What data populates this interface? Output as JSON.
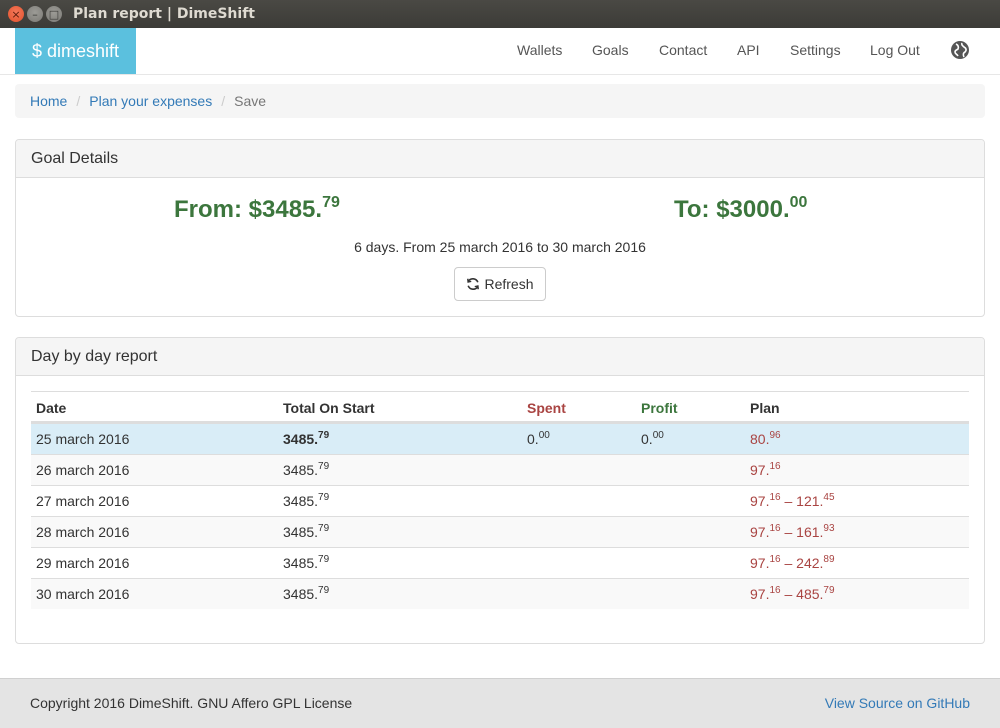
{
  "window": {
    "title": "Plan report | DimeShift",
    "close_glyph": "×",
    "minimize_glyph": "–",
    "maximize_glyph": "□"
  },
  "navbar": {
    "brand": "$ dimeshift",
    "items": [
      "Wallets",
      "Goals",
      "Contact",
      "API",
      "Settings",
      "Log Out"
    ],
    "globe_icon": "globe-icon"
  },
  "breadcrumb": {
    "items": [
      "Home",
      "Plan your expenses"
    ],
    "active": "Save",
    "separator": "/"
  },
  "goal": {
    "heading": "Goal Details",
    "from_label": "From: $3485.",
    "from_cents": "79",
    "to_label": "To: $3000.",
    "to_cents": "00",
    "period": "6 days. From 25 march 2016 to 30 march 2016",
    "refresh_label": "Refresh",
    "refresh_icon": "refresh-icon"
  },
  "report": {
    "heading": "Day by day report",
    "columns": [
      "Date",
      "Total On Start",
      "Spent",
      "Profit",
      "Plan"
    ],
    "rows": [
      {
        "date": "25 march 2016",
        "total_int": "3485.",
        "total_cents": "79",
        "spent_int": "0.",
        "spent_cents": "00",
        "profit_int": "0.",
        "profit_cents": "00",
        "plan_a_int": "80.",
        "plan_a_cents": "96",
        "plan_sep": "",
        "plan_b_int": "",
        "plan_b_cents": ""
      },
      {
        "date": "26 march 2016",
        "total_int": "3485.",
        "total_cents": "79",
        "spent_int": "",
        "spent_cents": "",
        "profit_int": "",
        "profit_cents": "",
        "plan_a_int": "97.",
        "plan_a_cents": "16",
        "plan_sep": "",
        "plan_b_int": "",
        "plan_b_cents": ""
      },
      {
        "date": "27 march 2016",
        "total_int": "3485.",
        "total_cents": "79",
        "spent_int": "",
        "spent_cents": "",
        "profit_int": "",
        "profit_cents": "",
        "plan_a_int": "97.",
        "plan_a_cents": "16",
        "plan_sep": " – ",
        "plan_b_int": "121.",
        "plan_b_cents": "45"
      },
      {
        "date": "28 march 2016",
        "total_int": "3485.",
        "total_cents": "79",
        "spent_int": "",
        "spent_cents": "",
        "profit_int": "",
        "profit_cents": "",
        "plan_a_int": "97.",
        "plan_a_cents": "16",
        "plan_sep": " – ",
        "plan_b_int": "161.",
        "plan_b_cents": "93"
      },
      {
        "date": "29 march 2016",
        "total_int": "3485.",
        "total_cents": "79",
        "spent_int": "",
        "spent_cents": "",
        "profit_int": "",
        "profit_cents": "",
        "plan_a_int": "97.",
        "plan_a_cents": "16",
        "plan_sep": " – ",
        "plan_b_int": "242.",
        "plan_b_cents": "89"
      },
      {
        "date": "30 march 2016",
        "total_int": "3485.",
        "total_cents": "79",
        "spent_int": "",
        "spent_cents": "",
        "profit_int": "",
        "profit_cents": "",
        "plan_a_int": "97.",
        "plan_a_cents": "16",
        "plan_sep": " – ",
        "plan_b_int": "485.",
        "plan_b_cents": "79"
      }
    ]
  },
  "footer": {
    "copyright": "Copyright 2016 DimeShift. GNU Affero GPL License",
    "github_link": "View Source on GitHub"
  },
  "colors": {
    "brand": "#5bc0de",
    "link": "#337ab7",
    "success": "#3c763d",
    "danger": "#a94442",
    "row_highlight": "#d9edf7"
  }
}
